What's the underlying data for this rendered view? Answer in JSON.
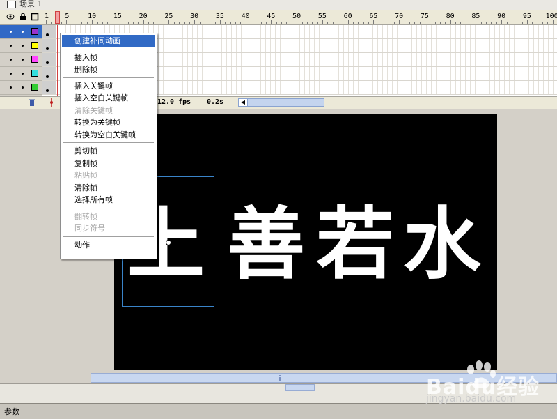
{
  "scene_bar": {
    "label": "场景 1",
    "icon": "scene-icon"
  },
  "timeline": {
    "ruler_numbers": [
      "1",
      "5",
      "10",
      "15",
      "20",
      "25",
      "30",
      "35",
      "40",
      "45",
      "50",
      "55",
      "60",
      "65",
      "70",
      "75",
      "80",
      "85",
      "90",
      "95",
      "100"
    ],
    "header_icons": [
      "eye-icon",
      "lock-icon",
      "outline-icon"
    ],
    "layers": [
      {
        "color": "#9932cc",
        "selected": true
      },
      {
        "color": "#ffff00",
        "selected": false
      },
      {
        "color": "#ff44ff",
        "selected": false
      },
      {
        "color": "#33dddd",
        "selected": false
      },
      {
        "color": "#33cc33",
        "selected": false
      }
    ],
    "fps": "12.0 fps",
    "elapsed": "0.2s",
    "playhead_frame": "1"
  },
  "context_menu": {
    "items": [
      {
        "label": "创建补间动画",
        "state": "highlighted"
      },
      {
        "sep": true
      },
      {
        "label": "插入帧",
        "state": "enabled"
      },
      {
        "label": "删除帧",
        "state": "enabled"
      },
      {
        "sep": true
      },
      {
        "label": "插入关键帧",
        "state": "enabled"
      },
      {
        "label": "插入空白关键帧",
        "state": "enabled"
      },
      {
        "label": "清除关键帧",
        "state": "disabled"
      },
      {
        "label": "转换为关键帧",
        "state": "enabled"
      },
      {
        "label": "转换为空白关键帧",
        "state": "enabled"
      },
      {
        "sep": true
      },
      {
        "label": "剪切帧",
        "state": "enabled"
      },
      {
        "label": "复制帧",
        "state": "enabled"
      },
      {
        "label": "粘贴帧",
        "state": "disabled"
      },
      {
        "label": "清除帧",
        "state": "enabled"
      },
      {
        "label": "选择所有帧",
        "state": "enabled"
      },
      {
        "sep": true
      },
      {
        "label": "翻转帧",
        "state": "disabled"
      },
      {
        "label": "同步符号",
        "state": "disabled"
      },
      {
        "sep": true
      },
      {
        "label": "动作",
        "state": "enabled"
      }
    ]
  },
  "stage": {
    "glyphs": [
      "上",
      "善",
      "若",
      "水"
    ],
    "background": "#000000",
    "text_color": "#ffffff",
    "selection_color": "#3a84c9"
  },
  "panels": {
    "params_label": "参数"
  },
  "watermark": {
    "text": "Baidu经验",
    "url": "jingyan.baidu.com"
  },
  "colors": {
    "accent": "#316ac5",
    "ui_gray": "#d4d0c8",
    "playhead": "#d04040"
  }
}
